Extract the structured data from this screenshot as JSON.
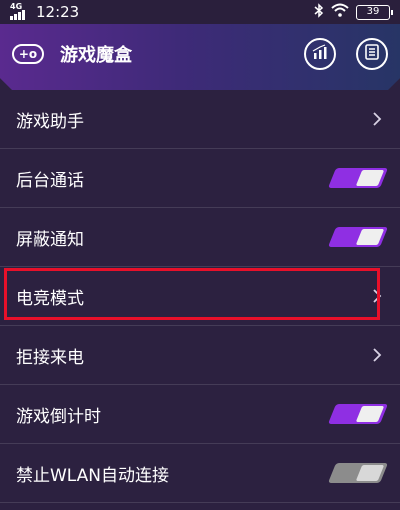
{
  "status_bar": {
    "network": "4G",
    "time": "12:23",
    "battery": "39"
  },
  "header": {
    "title": "游戏魔盒",
    "back_icon_text": "+o"
  },
  "settings": [
    {
      "label": "游戏助手",
      "control": "chevron"
    },
    {
      "label": "后台通话",
      "control": "toggle",
      "on": true
    },
    {
      "label": "屏蔽通知",
      "control": "toggle",
      "on": true
    },
    {
      "label": "电竞模式",
      "control": "chevron",
      "highlighted": true
    },
    {
      "label": "拒接来电",
      "control": "chevron"
    },
    {
      "label": "游戏倒计时",
      "control": "toggle",
      "on": true
    },
    {
      "label": "禁止WLAN自动连接",
      "control": "toggle",
      "on": false
    }
  ],
  "colors": {
    "toggle_on": "#8f2fe3",
    "toggle_off": "#8c8c8c",
    "highlight": "#e8102a",
    "background": "#2c2140"
  }
}
